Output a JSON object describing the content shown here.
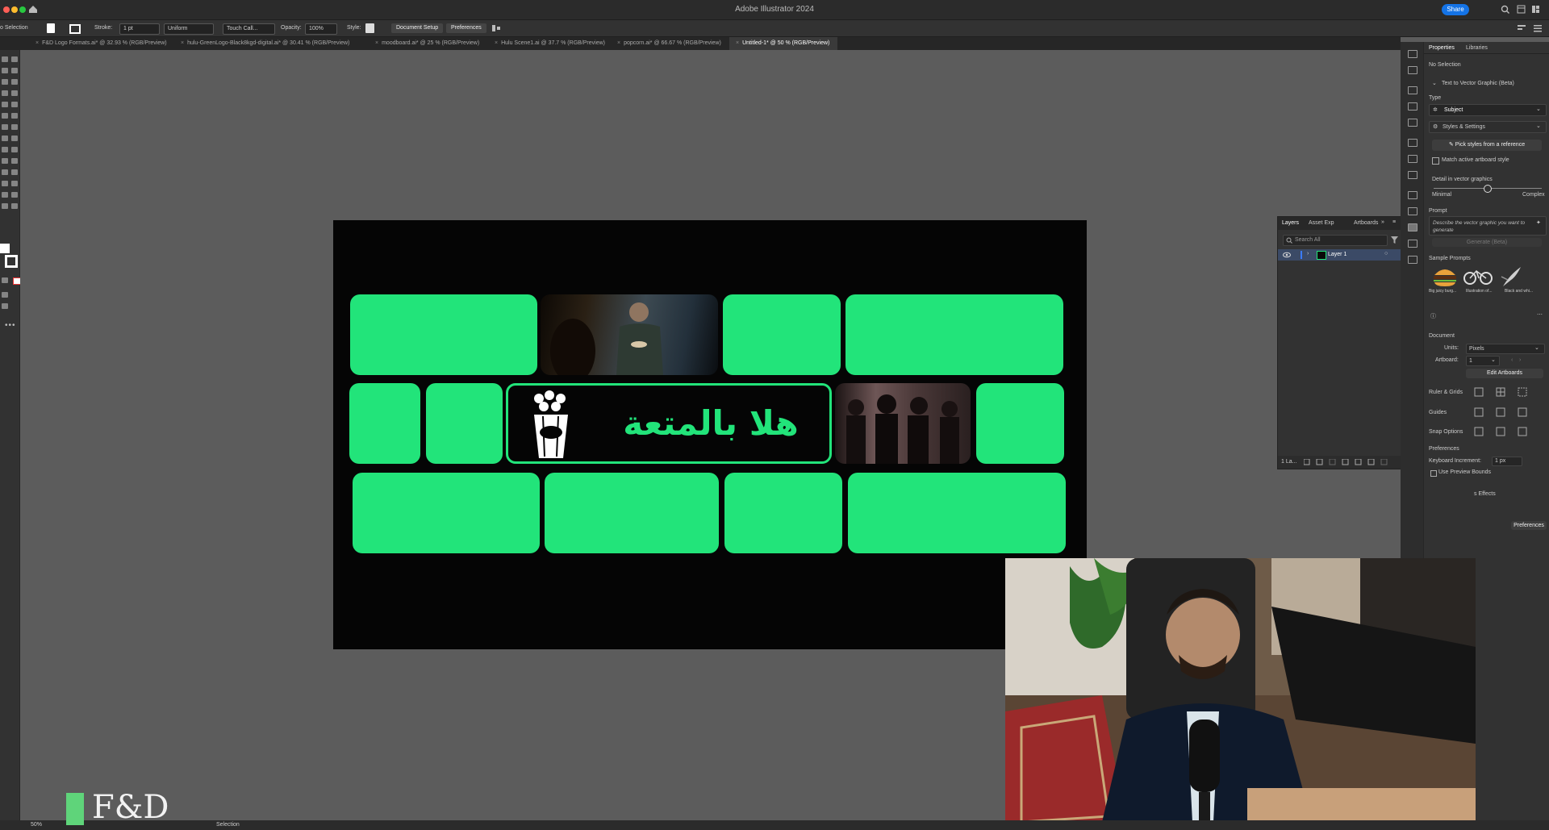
{
  "window": {
    "title": "Adobe Illustrator 2024",
    "share_label": "Share"
  },
  "control_bar": {
    "selection": "o Selection",
    "stroke_label": "Stroke:",
    "stroke_value": "1 pt",
    "profile": "Uniform",
    "brush": "Touch Call...",
    "opacity_label": "Opacity:",
    "opacity_value": "100%",
    "style_label": "Style:",
    "document_setup": "Document Setup",
    "preferences": "Preferences"
  },
  "doc_tabs": [
    "F&D Logo Formats.ai* @ 32.93 % (RGB/Preview)",
    "hulu-GreenLogo-Black8kgd-digital.ai* @ 30.41 % (RGB/Preview)",
    "moodboard.ai* @ 25 % (RGB/Preview)",
    "Hulu Scene1.ai @ 37.7 % (RGB/Preview)",
    "popcorn.ai* @ 66.67 % (RGB/Preview)",
    "Untitled-1* @ 50 % (RGB/Preview)"
  ],
  "artboard": {
    "arabic_text": "هلا بالمتعة",
    "accent": "#22e47a"
  },
  "layers_panel": {
    "tabs": [
      "Layers",
      "Asset Exp",
      "Artboards"
    ],
    "search_placeholder": "Search All",
    "layer_name": "Layer 1",
    "footer": "1 La..."
  },
  "properties": {
    "tabs": [
      "Properties",
      "Libraries"
    ],
    "selection": "No Selection",
    "section_t2v": "Text to Vector Graphic (Beta)",
    "type_label": "Type",
    "type_value": "Subject",
    "styles_settings": "Styles & Settings",
    "pick_styles": "Pick styles from a reference",
    "match_artboard": "Match active artboard style",
    "detail_label": "Detail in vector graphics",
    "detail_min": "Minimal",
    "detail_max": "Complex",
    "prompt_label": "Prompt",
    "prompt_placeholder": "Describe the vector graphic you want to generate",
    "generate": "Generate (Beta)",
    "sample_prompts": "Sample Prompts",
    "samples": [
      "Big juicy burg...",
      "Illustration of...",
      "Black and whi..."
    ],
    "document_label": "Document",
    "units_label": "Units:",
    "units_value": "Pixels",
    "artboard_label": "Artboard:",
    "artboard_value": "1",
    "edit_artboards": "Edit Artboards",
    "rulers_grids": "Ruler & Grids",
    "guides": "Guides",
    "snap_options": "Snap Options",
    "preferences_label": "Preferences",
    "keyboard_increment_label": "Keyboard Increment:",
    "keyboard_increment_value": "1 px",
    "use_preview_bounds": "Use Preview Bounds",
    "effects_fragment": "s Effects",
    "preferences_btn": "Preferences"
  },
  "status_bar": {
    "zoom": "50%",
    "tool": "Selection"
  },
  "logo": {
    "text": "F&D"
  }
}
